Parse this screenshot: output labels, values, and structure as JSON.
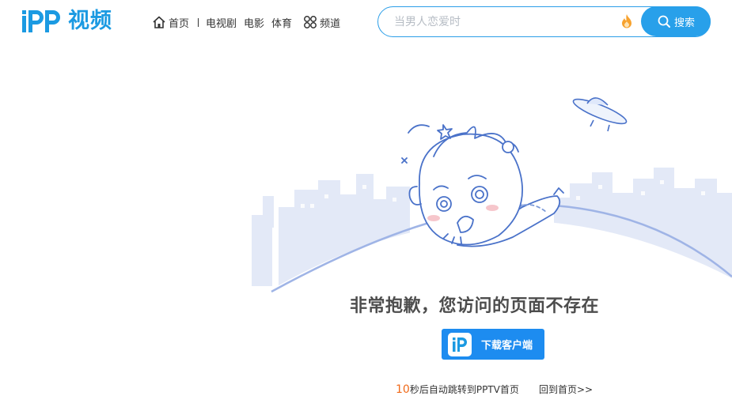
{
  "header": {
    "logo_text": "视频",
    "nav": {
      "home": "首页",
      "tv": "电视剧",
      "movie": "电影",
      "sports": "体育",
      "channels": "频道"
    },
    "search": {
      "placeholder": "当男人恋爱时",
      "button_label": "搜索"
    }
  },
  "main": {
    "error_message": "非常抱歉，您访问的页面不存在",
    "download_button": "下载客户端",
    "countdown_seconds": "10",
    "countdown_text": "秒后自动跳转到PPTV首页",
    "home_link": "回到首页>>"
  },
  "colors": {
    "brand_blue": "#1b9ae2",
    "button_blue": "#1d8cf0",
    "countdown_orange": "#f06a1a"
  },
  "icons": [
    "pptv-logo",
    "home-icon",
    "grid-icon",
    "fire-icon",
    "search-icon",
    "pptv-app-icon"
  ]
}
